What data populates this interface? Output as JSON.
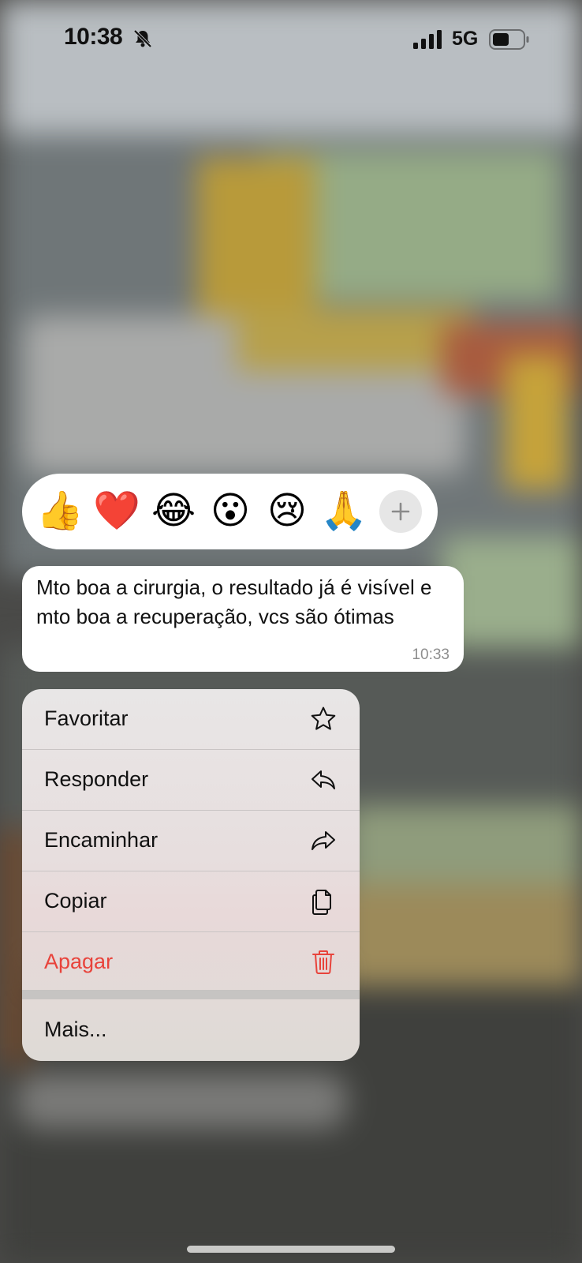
{
  "status_bar": {
    "time": "10:38",
    "network": "5G",
    "icons": [
      "bell-slash-icon",
      "signal-icon",
      "battery-icon"
    ]
  },
  "reactions": {
    "items": [
      {
        "emoji": "👍",
        "icon": "thumbs-up"
      },
      {
        "emoji": "❤️",
        "icon": "heart"
      },
      {
        "emoji": "😂",
        "icon": "tears-of-joy"
      },
      {
        "emoji": "😮",
        "icon": "surprised-face"
      },
      {
        "emoji": "😢",
        "icon": "crying-face"
      },
      {
        "emoji": "🙏",
        "icon": "folded-hands"
      }
    ],
    "more_icon": "plus-icon"
  },
  "message": {
    "text": "Mto boa a cirurgia, o resultado já é visível e mto boa a recuperação, vcs são ótimas",
    "time": "10:33"
  },
  "menu": {
    "favorite": {
      "label": "Favoritar",
      "icon": "star-icon"
    },
    "reply": {
      "label": "Responder",
      "icon": "reply-icon"
    },
    "forward": {
      "label": "Encaminhar",
      "icon": "forward-icon"
    },
    "copy": {
      "label": "Copiar",
      "icon": "copy-icon"
    },
    "delete": {
      "label": "Apagar",
      "icon": "trash-icon",
      "color": "#e8433b"
    },
    "more": {
      "label": "Mais..."
    }
  }
}
